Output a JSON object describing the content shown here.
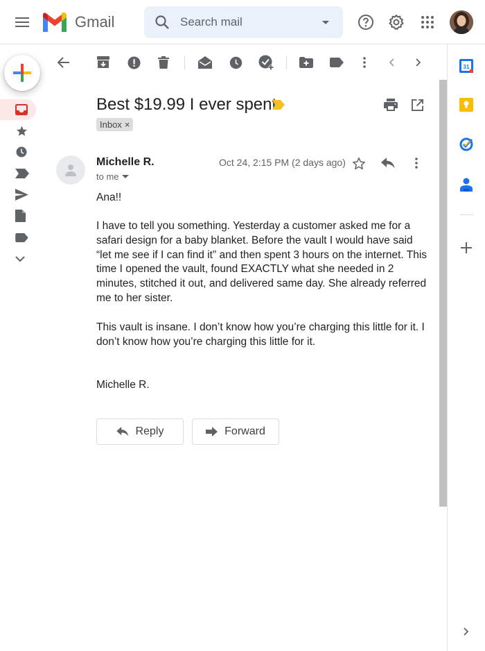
{
  "app": {
    "name": "Gmail"
  },
  "search": {
    "placeholder": "Search mail"
  },
  "colors": {
    "accent": "#ea4335",
    "inbox_active_bg": "#fce8e6",
    "search_bg": "#eaf1fb",
    "importance": "#f6bf26"
  },
  "header_icons": [
    "menu-icon",
    "search-icon",
    "caret-down-icon",
    "help-icon",
    "settings-icon",
    "apps-grid-icon"
  ],
  "left_nav": [
    "inbox-icon",
    "star-icon",
    "clock-icon",
    "label-icon",
    "send-icon",
    "file-icon",
    "label-icon",
    "chevron-down-icon"
  ],
  "toolbar_icons": [
    "back-arrow-icon",
    "archive-icon",
    "report-spam-icon",
    "trash-icon",
    "mark-unread-icon",
    "snooze-icon",
    "add-task-icon",
    "move-to-icon",
    "label-icon",
    "more-vert-icon",
    "chevron-left-icon",
    "chevron-right-icon"
  ],
  "email": {
    "subject": "Best $19.99 I ever spent",
    "label": "Inbox",
    "label_remove": "×",
    "sender": "Michelle R.",
    "recipient": "to me",
    "date": "Oct 24, 2:15 PM (2 days ago)",
    "greeting": "Ana!!",
    "paragraph1": "I have to tell you something. Yesterday a customer asked me for a safari design for a baby blanket. Before the vault I would have said “let me see if I can find it” and then spent 3 hours on the internet. This time I opened the vault, found EXACTLY what she needed in 2 minutes, stitched it out, and delivered same day. She already referred me to her sister.",
    "paragraph2": "This vault is insane. I don’t know how you’re charging this little for it. I don’t know how you’re charging this little for it.",
    "signature": "Michelle R."
  },
  "actions": {
    "reply": "Reply",
    "forward": "Forward"
  },
  "side_panel": [
    "calendar-icon",
    "keep-icon",
    "tasks-icon",
    "contacts-icon",
    "add-icon",
    "chevron-right-icon"
  ],
  "calendar_day": "31"
}
